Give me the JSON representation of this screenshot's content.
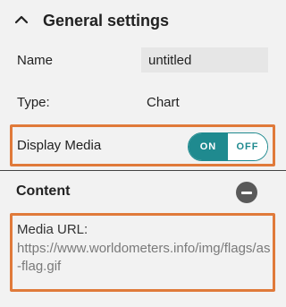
{
  "general_settings": {
    "title": "General settings",
    "chevron_icon": "chevron-up-icon",
    "name_label": "Name",
    "name_value": "untitled",
    "type_label": "Type:",
    "type_value": "Chart",
    "display_media_label": "Display Media",
    "display_media_toggle": {
      "on_label": "ON",
      "off_label": "OFF",
      "state": "on"
    }
  },
  "content": {
    "title": "Content",
    "collapse_icon": "minus-circle-icon",
    "media_url_label": "Media URL:",
    "media_url_value": "https://www.worldometers.info/img/flags/as-flag.gif"
  },
  "colors": {
    "toggle_accent": "#1f8a8f",
    "highlight_border": "#e07a3a",
    "background": "#f2f2f2"
  }
}
